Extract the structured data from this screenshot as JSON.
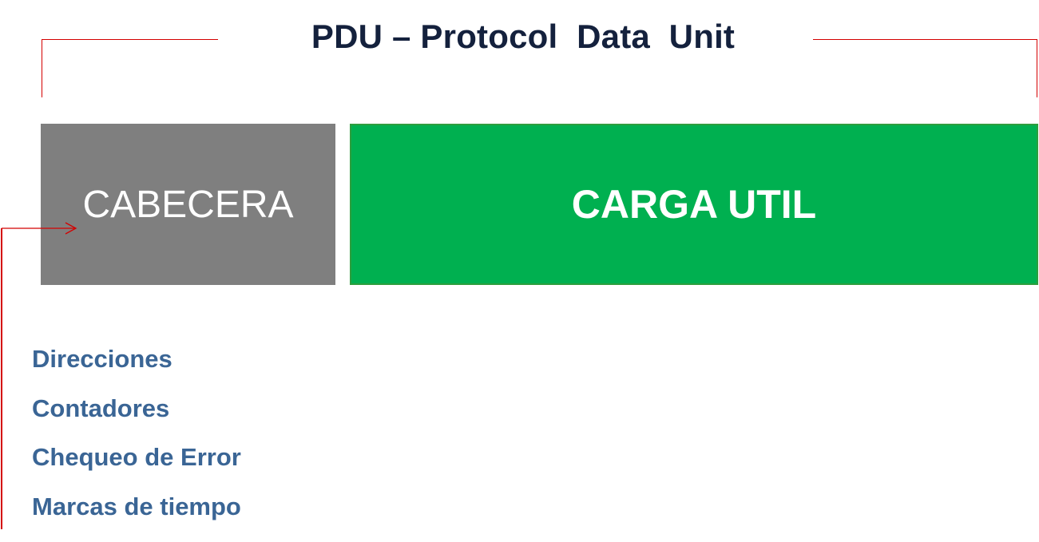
{
  "diagram": {
    "title": "PDU – Protocol  Data  Unit",
    "header_box": {
      "label": "CABECERA",
      "color": "#7f7f7f"
    },
    "payload_box": {
      "label": "CARGA UTIL",
      "color": "#00b050"
    },
    "header_fields": [
      "Direcciones",
      "Contadores",
      "Chequeo de Error",
      "Marcas de tiempo"
    ],
    "accent_color": "#d40000",
    "field_text_color": "#3a6595",
    "title_color": "#14213d"
  }
}
